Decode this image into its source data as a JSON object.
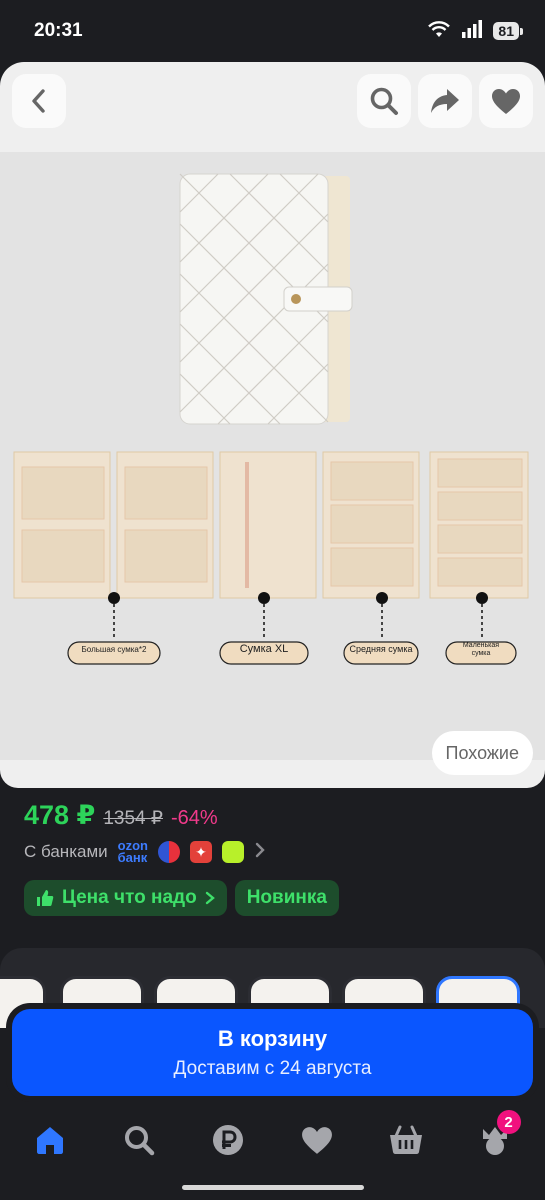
{
  "status": {
    "time": "20:31",
    "battery": "81"
  },
  "gallery": {
    "similar_label": "Похожие",
    "callouts": [
      "Большая сумка*2",
      "Сумка XL",
      "Средняя сумка",
      "Маленькая сумка"
    ]
  },
  "price": {
    "current": "478 ₽",
    "old": "1354 ₽",
    "discount": "-64%"
  },
  "banks": {
    "label": "С банками",
    "ozon_line1": "ozon",
    "ozon_line2": "банк"
  },
  "chips": {
    "deal": "Цена что надо",
    "new": "Новинка"
  },
  "cart": {
    "title": "В корзину",
    "subtitle": "Доставим с 24 августа"
  },
  "nav": {
    "cart_badge": "2"
  },
  "colors": {
    "accent": "#0a56ff",
    "price": "#2dd35a",
    "discount": "#f13a8b",
    "badge": "#f1117e"
  }
}
